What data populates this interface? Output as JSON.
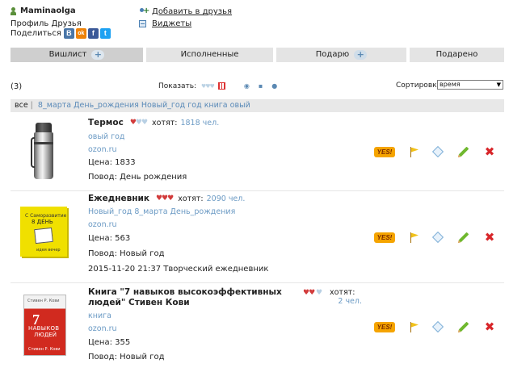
{
  "user": {
    "name": "Maminaolga",
    "profile_label": "Профиль",
    "friends_label": "Друзья",
    "share_label": "Поделиться",
    "social": [
      {
        "name": "vkontakte-icon",
        "glyph": "B",
        "color": "#4a76a8"
      },
      {
        "name": "odnoklassniki-icon",
        "glyph": "ok",
        "color": "#ee8208"
      },
      {
        "name": "facebook-icon",
        "glyph": "f",
        "color": "#3b5998"
      },
      {
        "name": "twitter-icon",
        "glyph": "t",
        "color": "#1da1f2"
      }
    ]
  },
  "links": {
    "add_friends": "Добавить в друзья",
    "widgets": "Виджеты"
  },
  "tabs": [
    {
      "label": "Вишлист",
      "active": true,
      "has_plus": true
    },
    {
      "label": "Исполненные",
      "active": false,
      "has_plus": false
    },
    {
      "label": "Подарю",
      "active": false,
      "has_plus": true
    },
    {
      "label": "Подарено",
      "active": false,
      "has_plus": false
    }
  ],
  "controls": {
    "count": "(3)",
    "show_label": "Показать:",
    "sort_label": "Сортировка:",
    "sort_value": "время"
  },
  "filter": {
    "all_label": "все",
    "tags": [
      "8_марта",
      "День_рождения",
      "Новый_год",
      "год",
      "книга",
      "овый"
    ]
  },
  "items": [
    {
      "title": "Термос",
      "hearts_red": 1,
      "hearts_blue": 2,
      "want_label": "хотят:",
      "want_count": "1818 чел.",
      "tags": "овый год",
      "shop": "ozon.ru",
      "price": "Цена: 1833",
      "occasion": "Повод: День рождения",
      "note": ""
    },
    {
      "title": "Ежедневник",
      "hearts_red": 3,
      "hearts_blue": 0,
      "want_label": "хотят:",
      "want_count": "2090 чел.",
      "tags": "Новый_год 8_марта День_рождения",
      "shop": "ozon.ru",
      "price": "Цена: 563",
      "occasion": "Повод: Новый год",
      "note": "2015-11-20 21:37 Творческий ежедневник"
    },
    {
      "title": "Книга \"7 навыков высокоэффективных людей\" Стивен Кови",
      "hearts_red": 2,
      "hearts_blue": 1,
      "want_label": "хотят:",
      "want_count": "2 чел.",
      "tags": "книга",
      "shop": "ozon.ru",
      "price": "Цена: 355",
      "occasion": "Повод: Новый год",
      "note": ""
    }
  ],
  "images": {
    "planner_line1": "С Саморазвитие",
    "planner_line2": "8 ДЕНЬ",
    "planner_line3": "идея вечер",
    "book_top": "Стивен Р. Кови",
    "book_num": "7",
    "book_line1": "НАВЫКОВ",
    "book_line2": "ЛЮДЕЙ",
    "book_author": "Стивен Р. Кови"
  },
  "actions": {
    "yes_label": "YES!"
  }
}
